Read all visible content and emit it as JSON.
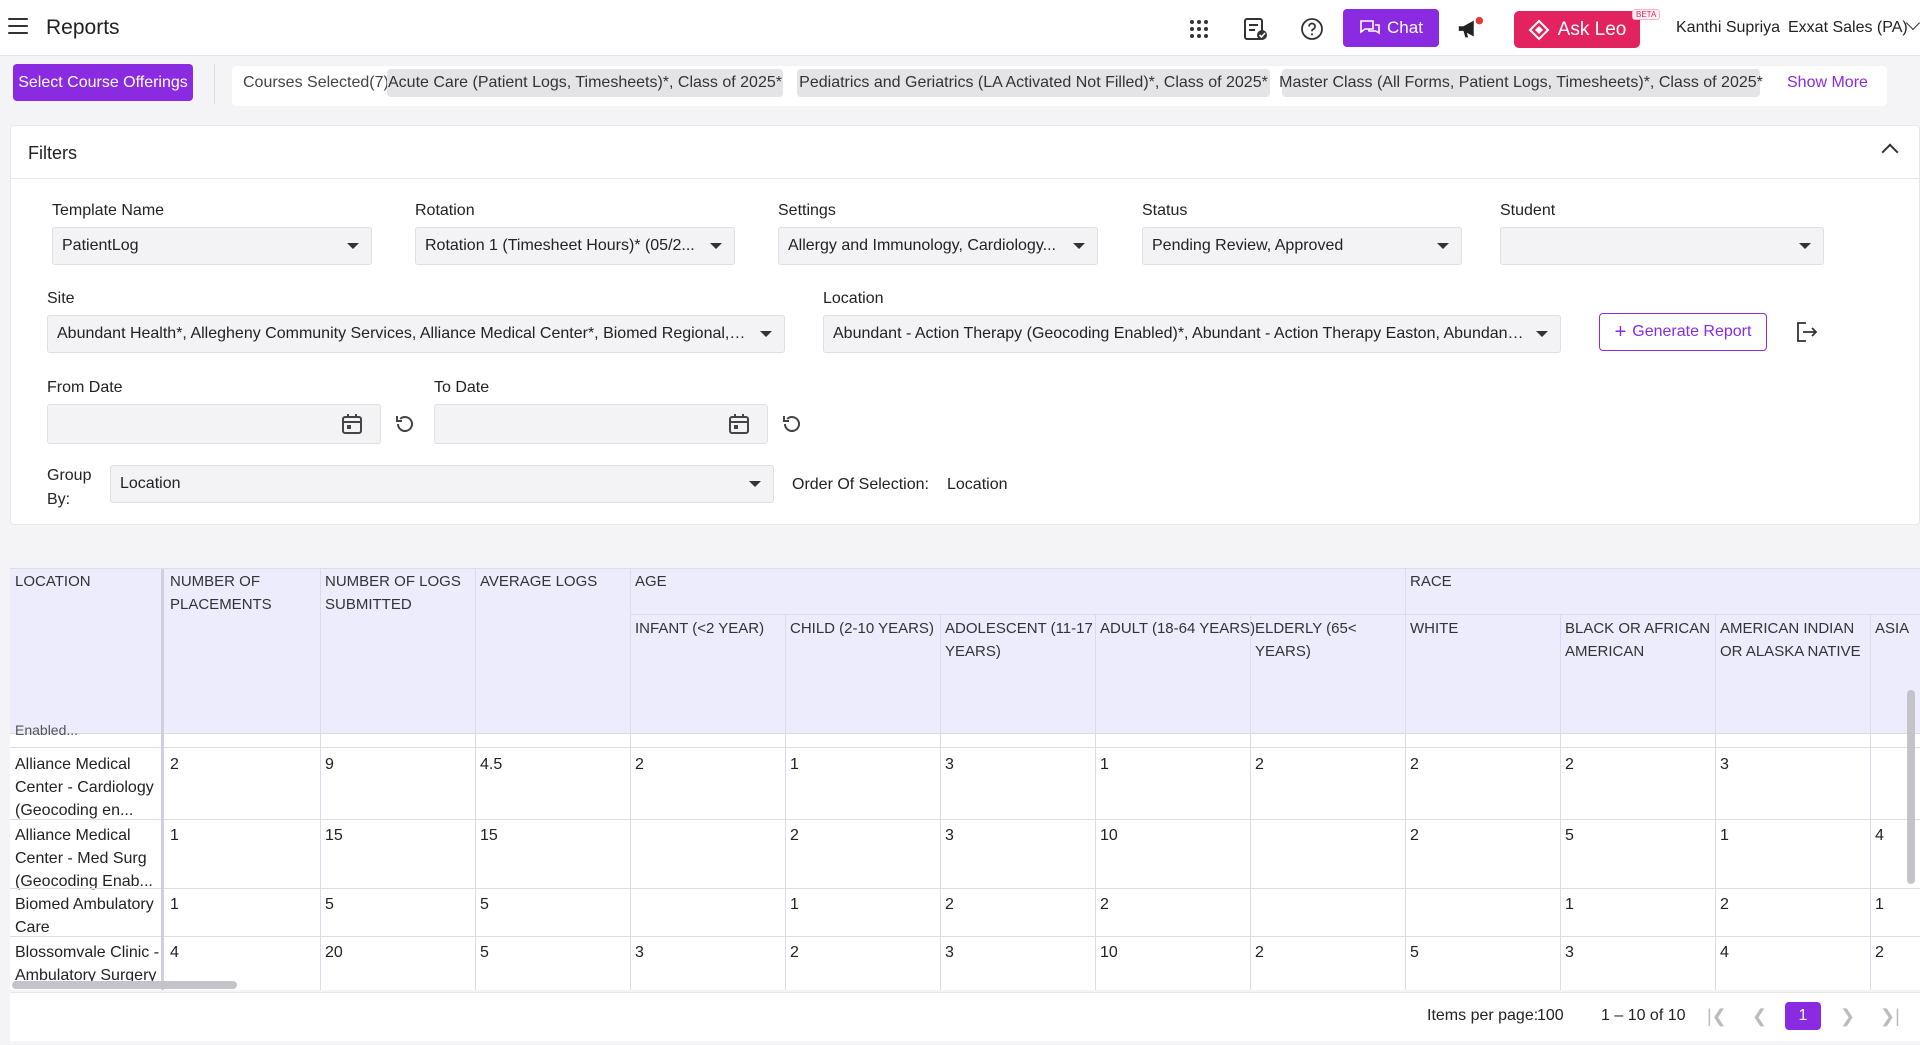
{
  "header": {
    "title": "Reports",
    "chat_label": "Chat",
    "ask_leo_label": "Ask Leo",
    "beta_label": "BETA",
    "user_name": "Kanthi Supriya",
    "org_name": "Exxat Sales (PA)"
  },
  "courses": {
    "select_button": "Select Course Offerings",
    "selected_label": "Courses Selected(7):",
    "chips": [
      "Acute Care (Patient Logs, Timesheets)*, Class of 2025*",
      "Pediatrics and Geriatrics (LA Activated Not Filled)*, Class of 2025*",
      "Master Class (All Forms, Patient Logs, Timesheets)*, Class of 2025*"
    ],
    "show_more": "Show More"
  },
  "filters": {
    "title": "Filters",
    "template_name": {
      "label": "Template Name",
      "value": "PatientLog"
    },
    "rotation": {
      "label": "Rotation",
      "value": "Rotation 1 (Timesheet Hours)* (05/2..."
    },
    "settings": {
      "label": "Settings",
      "value": "Allergy and Immunology, Cardiology..."
    },
    "status": {
      "label": "Status",
      "value": "Pending Review, Approved"
    },
    "student": {
      "label": "Student",
      "value": ""
    },
    "site": {
      "label": "Site",
      "value": "Abundant Health*, Allegheny Community Services, Alliance Medical Center*, Biomed Regional, Bl..."
    },
    "location": {
      "label": "Location",
      "value": "Abundant - Action Therapy (Geocoding Enabled)*, Abundant - Action Therapy Easton, Abundant -..."
    },
    "from_date": {
      "label": "From Date"
    },
    "to_date": {
      "label": "To Date"
    },
    "group_by": {
      "label_line1": "Group",
      "label_line2": "By:",
      "value": "Location"
    },
    "order_label": "Order Of Selection:",
    "order_value": "Location",
    "generate_button": "Generate Report"
  },
  "table": {
    "headers": {
      "location": "LOCATION",
      "placements": [
        "NUMBER OF",
        "PLACEMENTS"
      ],
      "logs": [
        "NUMBER OF LOGS",
        "SUBMITTED"
      ],
      "average": "AVERAGE LOGS",
      "age": "AGE",
      "race": "RACE",
      "infant": "INFANT (<2 YEAR)",
      "child": "CHILD (2-10 YEARS)",
      "adolescent": [
        "ADOLESCENT (11-17",
        "YEARS)"
      ],
      "adult": "ADULT (18-64 YEARS)",
      "elderly": [
        "ELDERLY (65<",
        "YEARS)"
      ],
      "white": "WHITE",
      "black": [
        "BLACK OR AFRICAN",
        "AMERICAN"
      ],
      "american_indian": [
        "AMERICAN INDIAN",
        "OR ALASKA NATIVE"
      ],
      "asian": "ASIA"
    },
    "partial_row_text": "Enabled...",
    "rows": [
      {
        "loc": [
          "Alliance Medical",
          "Center - Cardiology",
          "(Geocoding en..."
        ],
        "cells": [
          "2",
          "9",
          "4.5",
          "2",
          "1",
          "3",
          "1",
          "2",
          "2",
          "2",
          "3",
          ""
        ]
      },
      {
        "loc": [
          "Alliance Medical",
          "Center - Med Surg",
          "(Geocoding Enab..."
        ],
        "cells": [
          "1",
          "15",
          "15",
          "",
          "2",
          "3",
          "10",
          "",
          "2",
          "5",
          "1",
          "4"
        ]
      },
      {
        "loc": [
          "Biomed Ambulatory",
          "Care",
          ""
        ],
        "cells": [
          "1",
          "5",
          "5",
          "",
          "1",
          "2",
          "2",
          "",
          "",
          "1",
          "2",
          "1"
        ]
      },
      {
        "loc": [
          "Blossomvale Clinic -",
          "Ambulatory Surgery",
          ""
        ],
        "cells": [
          "4",
          "20",
          "5",
          "3",
          "2",
          "3",
          "10",
          "2",
          "5",
          "3",
          "4",
          "2"
        ]
      }
    ]
  },
  "pagination": {
    "items_per_page_label": "Items per page:",
    "items_per_page": "100",
    "range": "1 – 10 of 10",
    "current_page": "1"
  }
}
